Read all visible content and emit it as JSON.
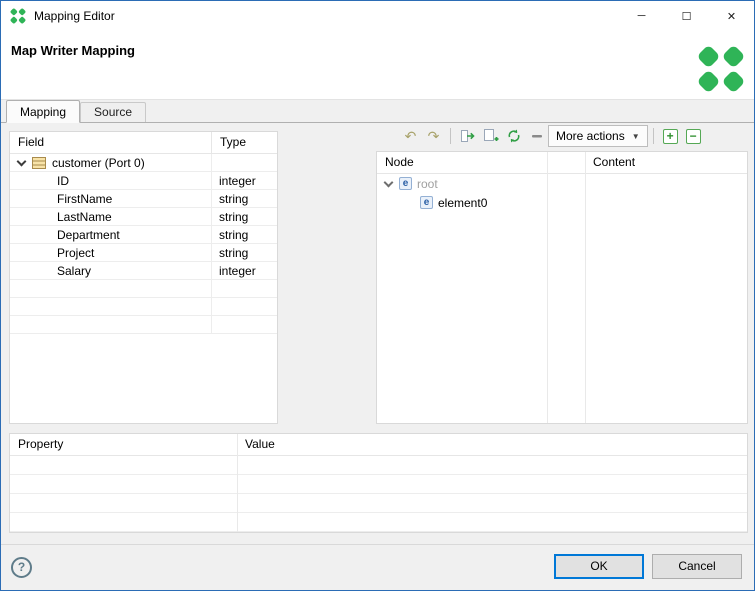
{
  "window": {
    "title": "Mapping Editor",
    "controls": {
      "minimize": "─",
      "maximize": "☐",
      "close": "✕"
    }
  },
  "header": {
    "title": "Map Writer Mapping"
  },
  "brand": {
    "green": "#2fb457"
  },
  "tabs": {
    "mapping": "Mapping",
    "source": "Source"
  },
  "toolbar": {
    "undo": "↶",
    "redo": "↷",
    "more_actions": "More actions",
    "dropdown": "▼",
    "expand_all": "+",
    "collapse_all": "−"
  },
  "field_table": {
    "columns": {
      "field": "Field",
      "type": "Type"
    },
    "root": {
      "label": "customer (Port 0)"
    },
    "rows": [
      {
        "field": "ID",
        "type": "integer"
      },
      {
        "field": "FirstName",
        "type": "string"
      },
      {
        "field": "LastName",
        "type": "string"
      },
      {
        "field": "Department",
        "type": "string"
      },
      {
        "field": "Project",
        "type": "string"
      },
      {
        "field": "Salary",
        "type": "integer"
      }
    ]
  },
  "node_table": {
    "columns": {
      "node": "Node",
      "content": "Content"
    },
    "rows": [
      {
        "label": "root",
        "icon": "e"
      },
      {
        "label": "element0",
        "icon": "e"
      }
    ]
  },
  "property_table": {
    "columns": {
      "property": "Property",
      "value": "Value"
    }
  },
  "footer": {
    "help": "?",
    "ok": "OK",
    "cancel": "Cancel"
  }
}
